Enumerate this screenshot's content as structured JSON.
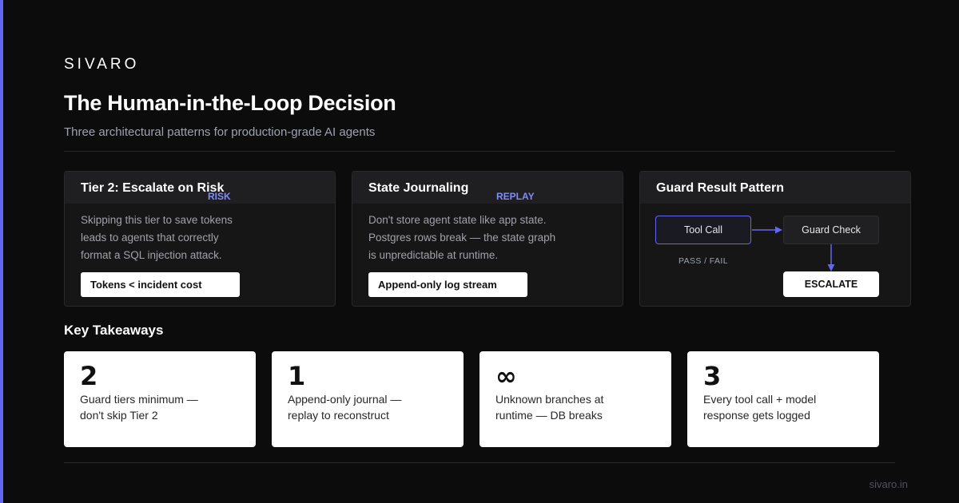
{
  "brand": "SIVARO",
  "title": "The Human-in-the-Loop Decision",
  "subtitle": "Three architectural patterns for production-grade AI agents",
  "cards": [
    {
      "title": "Tier 2: Escalate on Risk",
      "tag": "RISK",
      "body": [
        "Skipping this tier to save tokens",
        "leads to agents that correctly",
        "format a SQL injection attack."
      ],
      "pill": "Tokens < incident cost"
    },
    {
      "title": "State Journaling",
      "tag": "REPLAY",
      "body": [
        "Don't store agent state like app state.",
        "Postgres rows break — the state graph",
        "is unpredictable at runtime."
      ],
      "pill": "Append-only log stream"
    },
    {
      "title": "Guard Result Pattern",
      "diagram": {
        "tool_call": "Tool Call",
        "guard_check": "Guard Check",
        "pass_fail": "PASS / FAIL",
        "escalate": "ESCALATE"
      }
    }
  ],
  "takeaways_title": "Key Takeaways",
  "takeaways": [
    {
      "number": "2",
      "text": [
        "Guard tiers minimum —",
        "don't skip Tier 2"
      ]
    },
    {
      "number": "1",
      "text": [
        "Append-only journal —",
        "replay to reconstruct"
      ]
    },
    {
      "number": "∞",
      "text": [
        "Unknown branches at",
        "runtime — DB breaks"
      ]
    },
    {
      "number": "3",
      "text": [
        "Every tool call + model",
        "response gets logged"
      ]
    }
  ],
  "footer": "sivaro.in",
  "colors": {
    "accent": "#6366f1",
    "tag": "#818cf8",
    "background": "#0c0c0c",
    "card": "#161616"
  }
}
